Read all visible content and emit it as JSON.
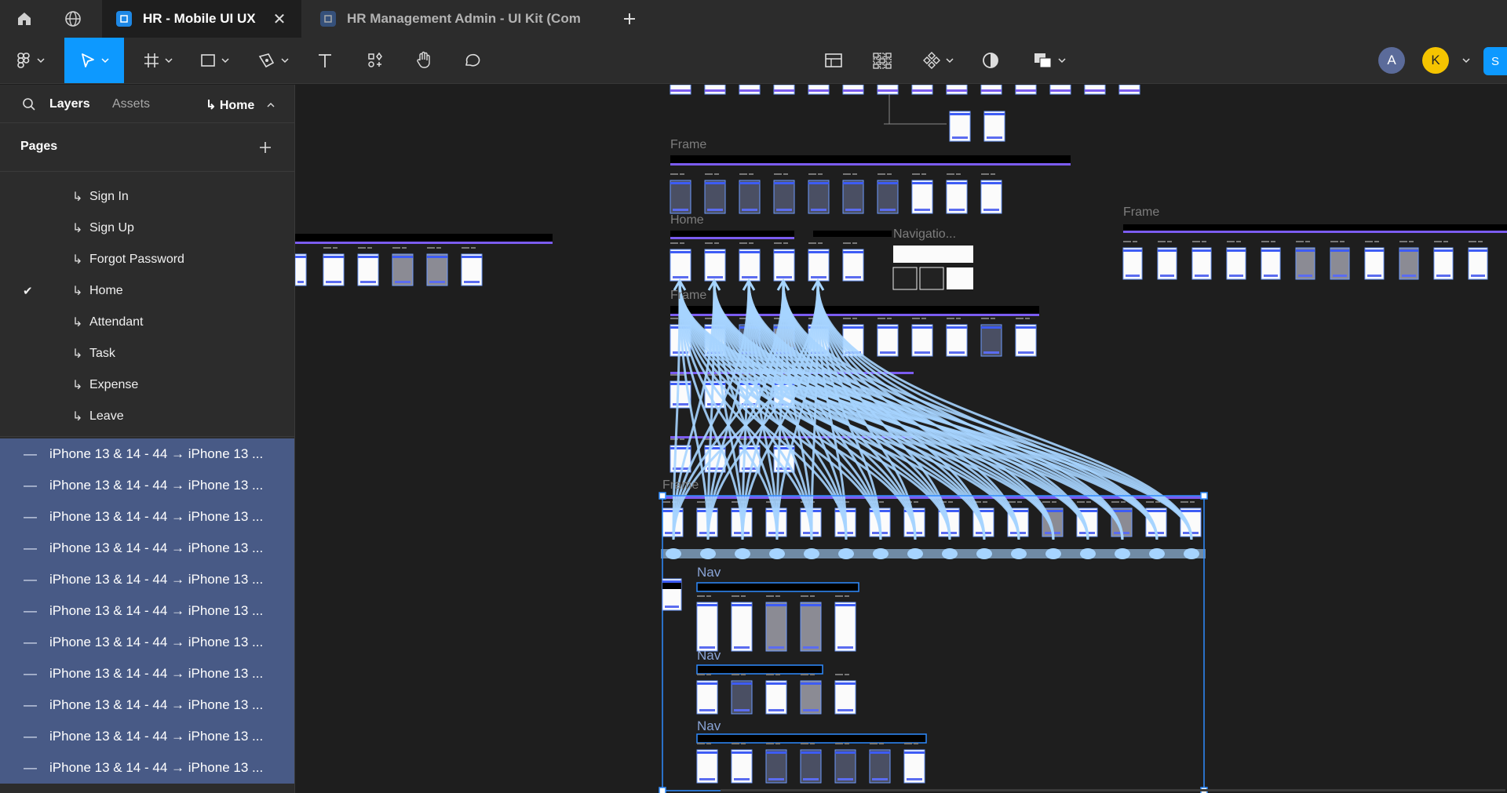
{
  "tabs": [
    {
      "label": "HR - Mobile UI UX",
      "active": true
    },
    {
      "label": "HR Management Admin - UI Kit (Com",
      "active": false
    }
  ],
  "toolbar": {
    "icons": [
      "figma-menu-icon",
      "move-tool-icon",
      "frame-tool-icon",
      "shape-tool-icon",
      "pen-tool-icon",
      "text-tool-icon",
      "resources-icon",
      "hand-tool-icon",
      "comment-tool-icon"
    ],
    "right_icons": [
      "layout-icon",
      "grid-icon",
      "component-icon",
      "contrast-icon",
      "boolean-icon"
    ],
    "avatars": [
      {
        "initial": "A",
        "color": "#5b6b9a"
      },
      {
        "initial": "K",
        "color": "#f5c400"
      }
    ],
    "share_label": "S"
  },
  "left_panel": {
    "tab_layers": "Layers",
    "tab_assets": "Assets",
    "page_selector": "↳ Home",
    "pages_title": "Pages",
    "pages": [
      {
        "label": "Sign In",
        "checked": false
      },
      {
        "label": "Sign Up",
        "checked": false
      },
      {
        "label": "Forgot Password",
        "checked": false
      },
      {
        "label": "Home",
        "checked": true
      },
      {
        "label": "Attendant",
        "checked": false
      },
      {
        "label": "Task",
        "checked": false
      },
      {
        "label": "Expense",
        "checked": false
      },
      {
        "label": "Leave",
        "checked": false
      }
    ],
    "layers": [
      "iPhone 13 & 14 - 44 → iPhone 13 ...",
      "iPhone 13 & 14 - 44 → iPhone 13 ...",
      "iPhone 13 & 14 - 44 → iPhone 13 ...",
      "iPhone 13 & 14 - 44 → iPhone 13 ...",
      "iPhone 13 & 14 - 44 → iPhone 13 ...",
      "iPhone 13 & 14 - 44 → iPhone 13 ...",
      "iPhone 13 & 14 - 44 → iPhone 13 ...",
      "iPhone 13 & 14 - 44 → iPhone 13 ...",
      "iPhone 13 & 14 - 44 → iPhone 13 ...",
      "iPhone 13 & 14 - 44 → iPhone 13 ...",
      "iPhone 13 & 14 - 44 → iPhone 13 ..."
    ]
  },
  "canvas": {
    "labels": {
      "frame1": "Frame",
      "home": "Home",
      "navigation": "Navigatio...",
      "frame2": "Frame",
      "frame3": "Frame",
      "frame4": "Frame",
      "nav1": "Nav",
      "nav2": "Nav",
      "nav3": "Nav"
    }
  }
}
